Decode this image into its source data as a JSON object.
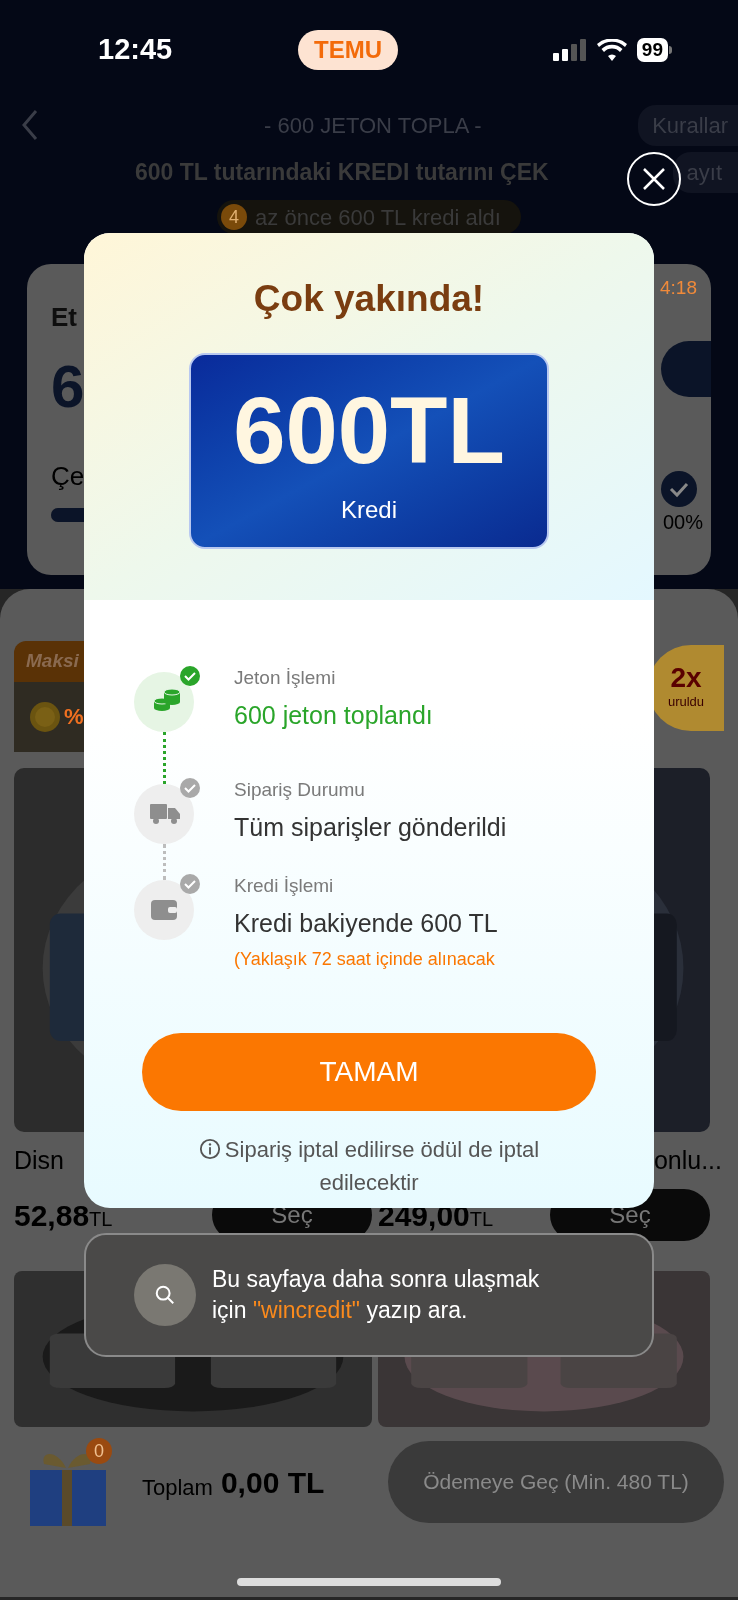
{
  "status_bar": {
    "time": "12:45",
    "app_badge": "TEMU",
    "battery": "99"
  },
  "header": {
    "title": "- 600 JETON TOPLA -",
    "rules_button": "Kurallar",
    "subtitle": "600 TL tutarındaki KREDI tutarını ÇEK",
    "records_button": "ayıt",
    "ticker": {
      "count": "4",
      "text": "az önce 600 TL kredi aldı"
    }
  },
  "progress_card": {
    "label": "Et",
    "amount": "6",
    "progress_label": "Çe",
    "timer": "4:18",
    "percent": "00%",
    "level": 1
  },
  "promo": {
    "tab": "Maksi",
    "coin_text": "%",
    "multiplier": "2x",
    "multiplier_note": "uruldu"
  },
  "products": [
    {
      "name": "Disn",
      "price": "52,88",
      "currency": "TL",
      "button": "Seç"
    },
    {
      "name": "onlu...",
      "price": "249,00",
      "currency": "TL",
      "button": "Seç"
    }
  ],
  "cart": {
    "badge": "0",
    "total_label": "Toplam",
    "total": "0,00 TL",
    "checkout_button": "Ödemeye Geç (Min. 480 TL)"
  },
  "modal": {
    "title": "Çok yakında!",
    "amount": "600TL",
    "amount_label": "Kredi",
    "steps": [
      {
        "kind": "coins",
        "label": "Jeton İşlemi",
        "value": "600 jeton toplandı",
        "highlighted": true
      },
      {
        "kind": "truck",
        "label": "Sipariş Durumu",
        "value": "Tüm siparişler gönderildi",
        "highlighted": false
      },
      {
        "kind": "wallet",
        "label": "Kredi İşlemi",
        "value": "Kredi bakiyende 600 TL",
        "note": "(Yaklaşık 72 saat içinde alınacak",
        "highlighted": false
      }
    ],
    "button": "TAMAM",
    "footnote": "Sipariş iptal edilirse ödül de iptal edilecektir"
  },
  "toast": {
    "text_before": "Bu sayfaya daha sonra ulaşmak için ",
    "keyword": "\"wincredit\"",
    "text_after": " yazıp ara."
  }
}
